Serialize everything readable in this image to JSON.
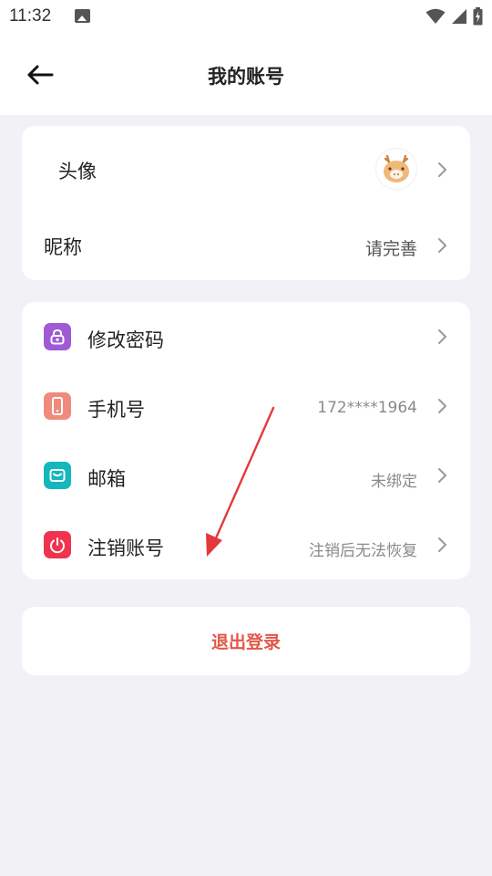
{
  "status_bar": {
    "time": "11:32"
  },
  "header": {
    "title": "我的账号"
  },
  "profile": {
    "avatar_label": "头像",
    "nickname_label": "昵称",
    "nickname_value": "请完善"
  },
  "account": {
    "items": [
      {
        "label": "修改密码",
        "value": "",
        "icon": "lock-icon",
        "color": "#a05ad6"
      },
      {
        "label": "手机号",
        "value": "172****1964",
        "icon": "phone-icon",
        "color": "#ef8a7d"
      },
      {
        "label": "邮箱",
        "value": "未绑定",
        "icon": "mail-icon",
        "color": "#14b7bd"
      },
      {
        "label": "注销账号",
        "value": "注销后无法恢复",
        "icon": "power-icon",
        "color": "#f0334f"
      }
    ]
  },
  "logout": {
    "label": "退出登录"
  },
  "colors": {
    "accent": "#e25748",
    "background": "#f2f2f6",
    "annotation_arrow": "#e3393c"
  }
}
